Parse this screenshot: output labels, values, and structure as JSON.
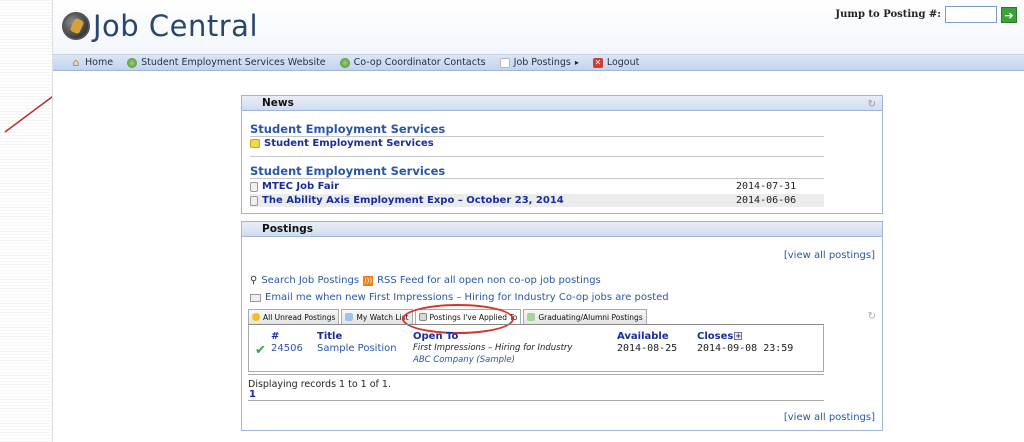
{
  "header": {
    "logo_text": "Job Central",
    "jump_label": "Jump to Posting #:",
    "jump_value": "",
    "go_symbol": "➔"
  },
  "nav": {
    "items": [
      {
        "label": "Home",
        "icon": "home-icon"
      },
      {
        "label": "Student Employment Services Website",
        "icon": "globe-icon"
      },
      {
        "label": "Co-op Coordinator Contacts",
        "icon": "globe-icon"
      },
      {
        "label": "Job Postings",
        "icon": "document-icon"
      },
      {
        "label": "Logout",
        "icon": "logout-icon"
      }
    ],
    "submenu_arrow": "▸"
  },
  "news": {
    "title": "News",
    "sections": [
      {
        "heading": "Student Employment Services",
        "items": [
          {
            "title": "Student Employment Services",
            "date": ""
          }
        ]
      },
      {
        "heading": "Student Employment Services",
        "items": [
          {
            "title": "MTEC Job Fair",
            "date": "2014-07-31"
          },
          {
            "title": "The Ability Axis Employment Expo – October 23, 2014",
            "date": "2014-06-06"
          }
        ]
      }
    ]
  },
  "postings": {
    "title": "Postings",
    "view_all": "[view all postings]",
    "search_label": "Search Job Postings",
    "rss_label": "RSS Feed for all open non co-op job postings",
    "email_label": "Email me when new First Impressions – Hiring for Industry Co-op jobs are posted",
    "tabs": [
      {
        "label": "All Unread Postings",
        "active": false
      },
      {
        "label": "My Watch List",
        "active": false
      },
      {
        "label": "Postings I've Applied To",
        "active": true
      },
      {
        "label": "Graduating/Alumni Postings",
        "active": false
      }
    ],
    "columns": {
      "number": "#",
      "title": "Title",
      "open_to": "Open To",
      "available": "Available",
      "closes": "Closes"
    },
    "rows": [
      {
        "number": "24506",
        "title": "Sample Position",
        "open_to": "First Impressions – Hiring for Industry",
        "company": "ABC Company (Sample)",
        "available": "2014-08-25",
        "closes": "2014-09-08 23:59"
      }
    ],
    "records_text": "Displaying records 1 to 1 of 1.",
    "page": "1"
  },
  "colors": {
    "accent": "#2a56a8",
    "link": "#1a2c9e",
    "annotation": "#d8332a",
    "arrow": "#b3302a"
  }
}
